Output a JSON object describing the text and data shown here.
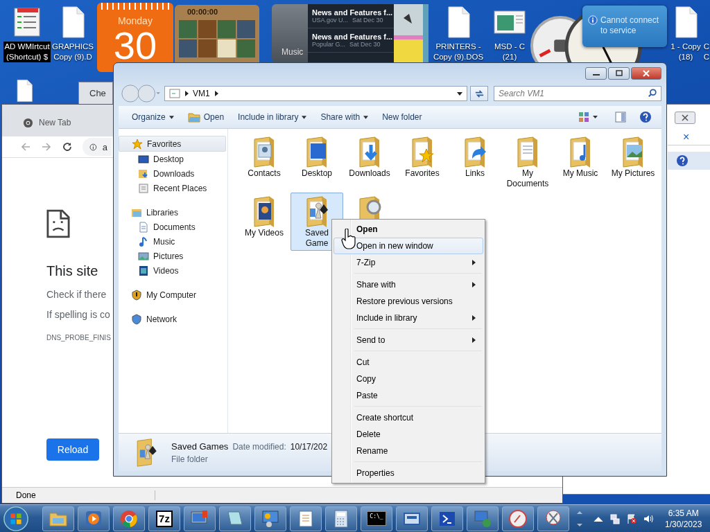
{
  "desktop": {
    "icons": [
      {
        "kind": "shortcut",
        "lines": [
          "AD WMIrtcut",
          "(Shortcut) $"
        ],
        "selected": true
      },
      {
        "kind": "file",
        "lines": [
          "GRAPHICS",
          "Copy (9).D"
        ],
        "selected": false
      },
      {
        "kind": "file",
        "lines": [
          "PRINTERS -",
          "Copy (9).DOS"
        ],
        "selected": false
      },
      {
        "kind": "window",
        "lines": [
          "MSD - C",
          "(21)"
        ],
        "selected": false
      },
      {
        "kind": "file",
        "lines": [
          "1 - Copy",
          "(18)"
        ],
        "selected": false
      },
      {
        "kind": "edge",
        "lines": [
          "C",
          "C"
        ],
        "selected": false
      }
    ]
  },
  "gadgets": {
    "calendar": {
      "weekday": "Monday",
      "day": "30"
    },
    "puzzle": {
      "timer": "00:00:00"
    },
    "feeds": [
      {
        "title": "News and Features f...",
        "source": "USA.gov U...",
        "date": "Sat Dec 30"
      },
      {
        "title": "News and Features f...",
        "source": "Popular G...",
        "date": "Sat Dec 30"
      }
    ],
    "music": {
      "label": "Music"
    },
    "balloon": {
      "text": "Cannot connect to service"
    }
  },
  "browser": {
    "tab": "New Tab",
    "address": "a",
    "heading": "This site",
    "lines": [
      "Check if there",
      "If spelling is co"
    ],
    "code": "DNS_PROBE_FINIS",
    "button": "Reload",
    "status": "Done",
    "back_tab": "Che"
  },
  "back_window": {
    "close": "×"
  },
  "explorer": {
    "path": [
      "VM1"
    ],
    "search": {
      "placeholder": "Search VM1"
    },
    "toolbar": [
      {
        "label": "Organize",
        "menu": true,
        "kind": "text"
      },
      {
        "label": "Open",
        "menu": false,
        "kind": "open"
      },
      {
        "label": "Include in library",
        "menu": true,
        "kind": "text"
      },
      {
        "label": "Share with",
        "menu": true,
        "kind": "text"
      },
      {
        "label": "New folder",
        "menu": false,
        "kind": "text"
      }
    ],
    "nav": [
      {
        "label": "Favorites",
        "kind": "star",
        "selected": true,
        "children": [
          {
            "label": "Desktop",
            "kind": "desktop",
            "selected": false
          },
          {
            "label": "Downloads",
            "kind": "downloads",
            "selected": false
          },
          {
            "label": "Recent Places",
            "kind": "recent",
            "selected": false
          }
        ]
      },
      {
        "label": "Libraries",
        "kind": "library",
        "selected": false,
        "children": [
          {
            "label": "Documents",
            "kind": "documents",
            "selected": false
          },
          {
            "label": "Music",
            "kind": "music",
            "selected": false
          },
          {
            "label": "Pictures",
            "kind": "pictures",
            "selected": false
          },
          {
            "label": "Videos",
            "kind": "videos",
            "selected": false
          }
        ]
      },
      {
        "label": "My Computer",
        "kind": "computer",
        "selected": false
      },
      {
        "label": "Network",
        "kind": "network",
        "selected": false
      }
    ],
    "items": [
      {
        "label": "Contacts",
        "kind": "contacts",
        "selected": false
      },
      {
        "label": "Desktop",
        "kind": "desktop",
        "selected": false
      },
      {
        "label": "Downloads",
        "kind": "downloads",
        "selected": false
      },
      {
        "label": "Favorites",
        "kind": "star",
        "selected": false
      },
      {
        "label": "Links",
        "kind": "links",
        "selected": false
      },
      {
        "label": "My Documents",
        "kind": "documents",
        "selected": false
      },
      {
        "label": "My Music",
        "kind": "music",
        "selected": false
      },
      {
        "label": "My Pictures",
        "kind": "pictures",
        "selected": false
      },
      {
        "label": "My Videos",
        "kind": "videos",
        "selected": false
      },
      {
        "label": "Saved Game",
        "kind": "games",
        "selected": true
      },
      {
        "kind": "search",
        "selected": false
      }
    ],
    "status": {
      "name": "Saved Games",
      "date_label": "Date modified:",
      "date": "10/17/202",
      "type": "File folder"
    }
  },
  "context_menu": {
    "groups": [
      [
        {
          "label": "Open",
          "bold": true,
          "submenu": false,
          "selected": false
        },
        {
          "label": "Open in new window",
          "bold": false,
          "submenu": false,
          "selected": true
        },
        {
          "label": "7-Zip",
          "bold": false,
          "submenu": true,
          "selected": false
        }
      ],
      [
        {
          "label": "Share with",
          "bold": false,
          "submenu": true,
          "selected": false
        },
        {
          "label": "Restore previous versions",
          "bold": false,
          "submenu": false,
          "selected": false
        },
        {
          "label": "Include in library",
          "bold": false,
          "submenu": true,
          "selected": false
        }
      ],
      [
        {
          "label": "Send to",
          "bold": false,
          "submenu": true,
          "selected": false
        }
      ],
      [
        {
          "label": "Cut",
          "bold": false,
          "submenu": false,
          "selected": false
        },
        {
          "label": "Copy",
          "bold": false,
          "submenu": false,
          "selected": false
        },
        {
          "label": "Paste",
          "bold": false,
          "submenu": false,
          "selected": false
        }
      ],
      [
        {
          "label": "Create shortcut",
          "bold": false,
          "submenu": false,
          "selected": false
        },
        {
          "label": "Delete",
          "bold": false,
          "submenu": false,
          "selected": false
        },
        {
          "label": "Rename",
          "bold": false,
          "submenu": false,
          "selected": false
        }
      ],
      [
        {
          "label": "Properties",
          "bold": false,
          "submenu": false,
          "selected": false
        }
      ]
    ]
  },
  "taskbar": {
    "buttons": [
      {
        "kind": "folder"
      },
      {
        "kind": "media"
      },
      {
        "kind": "browser"
      },
      {
        "kind": "sevenzip",
        "text": "7z"
      },
      {
        "kind": "monitor"
      },
      {
        "kind": "notepad"
      },
      {
        "kind": "panel"
      },
      {
        "kind": "document"
      },
      {
        "kind": "calculator"
      },
      {
        "kind": "console",
        "text": "C:\\_"
      },
      {
        "kind": "window"
      },
      {
        "kind": "shell"
      },
      {
        "kind": "remote"
      },
      {
        "kind": "compass"
      },
      {
        "kind": "scissors"
      }
    ],
    "time": "6:35 AM",
    "date": "1/30/2023"
  }
}
